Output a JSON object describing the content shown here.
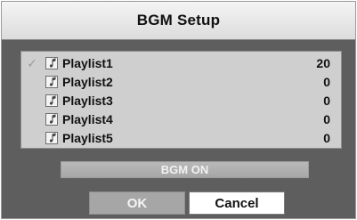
{
  "dialog": {
    "title": "BGM Setup",
    "playlists": [
      {
        "label": "Playlist1",
        "count": "20",
        "checked": true
      },
      {
        "label": "Playlist2",
        "count": "0",
        "checked": false
      },
      {
        "label": "Playlist3",
        "count": "0",
        "checked": false
      },
      {
        "label": "Playlist4",
        "count": "0",
        "checked": false
      },
      {
        "label": "Playlist5",
        "count": "0",
        "checked": false
      }
    ],
    "bgm_toggle_label": "BGM ON",
    "ok_label": "OK",
    "cancel_label": "Cancel",
    "icons": {
      "check": "checkmark-icon",
      "playlist": "music-note-icon"
    },
    "colors": {
      "dialog_bg": "#5e5e5e",
      "list_bg": "#cfcfcf",
      "title_bg": "#e6e6e6",
      "ok_bg": "#a6a6a6",
      "cancel_bg": "#ffffff"
    }
  }
}
